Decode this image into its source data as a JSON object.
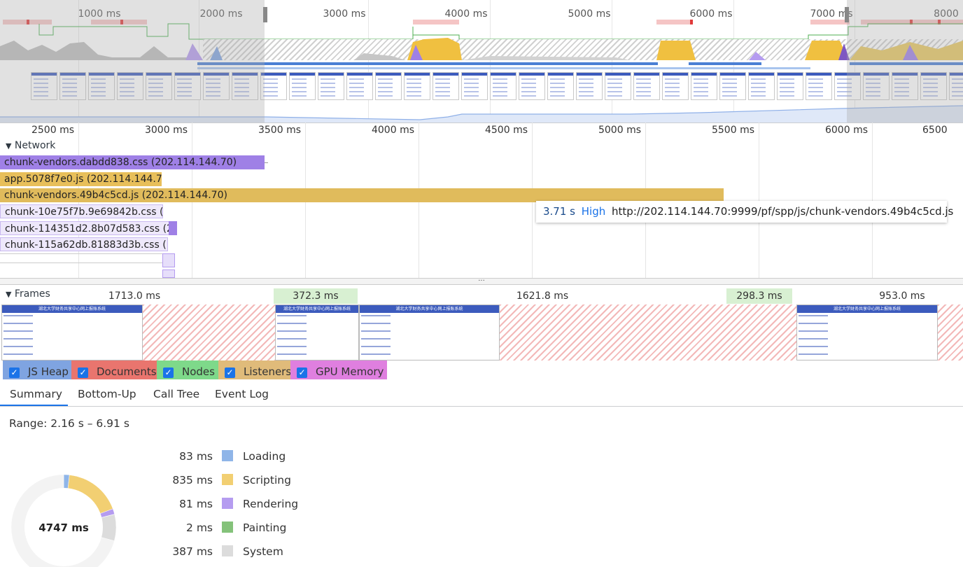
{
  "overview": {
    "ticks": [
      "1000 ms",
      "2000 ms",
      "3000 ms",
      "4000 ms",
      "5000 ms",
      "6000 ms",
      "7000 ms",
      "8000"
    ]
  },
  "ruler": {
    "ticks": [
      "2500 ms",
      "3000 ms",
      "3500 ms",
      "4000 ms",
      "4500 ms",
      "5000 ms",
      "5500 ms",
      "6000 ms",
      "6500"
    ]
  },
  "network": {
    "title": "Network",
    "requests": [
      {
        "label": "chunk-vendors.dabdd838.css (202.114.144.70)",
        "color": "#9f80e6"
      },
      {
        "label": "app.5078f7e0.js (202.114.144.70)",
        "color": "#e8bf5a"
      },
      {
        "label": "chunk-vendors.49b4c5cd.js (202.114.144.70)",
        "color": "#e8bf5a"
      },
      {
        "label": "chunk-10e75f7b.9e69842b.css (…",
        "color": "#e6defa"
      },
      {
        "label": "chunk-114351d2.8b07d583.css (2…",
        "color": "#e6defa"
      },
      {
        "label": "chunk-115a62db.81883d3b.css (…",
        "color": "#e6defa"
      }
    ],
    "tooltip": {
      "time": "3.71 s",
      "priority": "High",
      "url": "http://202.114.144.70:9999/pf/spp/js/chunk-vendors.49b4c5cd.js"
    },
    "more": "..."
  },
  "frames": {
    "title": "Frames",
    "durations": [
      "1713.0 ms",
      "372.3 ms",
      "1621.8 ms",
      "298.3 ms",
      "953.0 ms"
    ],
    "screenshot_title": "湖北大学财务共享中心网上报账系统"
  },
  "legend": [
    {
      "label": "JS Heap",
      "color": "#7fa4e1"
    },
    {
      "label": "Documents",
      "color": "#e9756e"
    },
    {
      "label": "Nodes",
      "color": "#7ed98a"
    },
    {
      "label": "Listeners",
      "color": "#e0bb7a"
    },
    {
      "label": "GPU Memory",
      "color": "#df7fdf"
    }
  ],
  "tabs": [
    "Summary",
    "Bottom-Up",
    "Call Tree",
    "Event Log"
  ],
  "summary": {
    "range": "Range: 2.16 s – 6.91 s",
    "total": "4747 ms",
    "rows": [
      {
        "value": "83 ms",
        "label": "Loading",
        "color": "#8fb5e8",
        "ms": 83
      },
      {
        "value": "835 ms",
        "label": "Scripting",
        "color": "#f2cf72",
        "ms": 835
      },
      {
        "value": "81 ms",
        "label": "Rendering",
        "color": "#b59cf0",
        "ms": 81
      },
      {
        "value": "2 ms",
        "label": "Painting",
        "color": "#84c27a",
        "ms": 2
      },
      {
        "value": "387 ms",
        "label": "System",
        "color": "#dcdcdc",
        "ms": 387
      }
    ]
  }
}
